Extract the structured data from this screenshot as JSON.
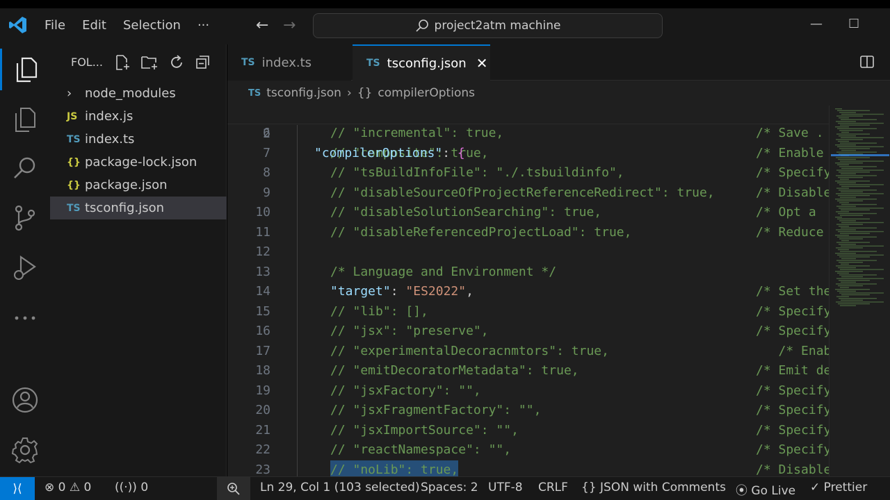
{
  "titlebar": {
    "menu": [
      "File",
      "Edit",
      "Selection",
      "···"
    ],
    "search_text": "project2atm machine",
    "back_arrow": "←",
    "forward_arrow": "→",
    "minimize": "—",
    "maximize": "☐"
  },
  "sidebar": {
    "header": "FOL...",
    "items": [
      {
        "icon": "›",
        "label": "node_modules",
        "type": "folder"
      },
      {
        "icon": "JS",
        "label": "index.js",
        "type": "js"
      },
      {
        "icon": "TS",
        "label": "index.ts",
        "type": "ts"
      },
      {
        "icon": "{}",
        "label": "package-lock.json",
        "type": "json"
      },
      {
        "icon": "{}",
        "label": "package.json",
        "type": "json"
      },
      {
        "icon": "TS",
        "label": "tsconfig.json",
        "type": "ts",
        "selected": true
      }
    ]
  },
  "tabs": [
    {
      "icon": "TS",
      "label": "index.ts"
    },
    {
      "icon": "TS",
      "label": "tsconfig.json",
      "close": "✕"
    }
  ],
  "breadcrumb": {
    "file_icon": "TS",
    "file": "tsconfig.json",
    "sep": "›",
    "symbol_icon": "{}",
    "symbol": "compilerOptions"
  },
  "editor": {
    "sticky": {
      "ln": "2",
      "key": "\"compilerOptions\"",
      "colon": ": ",
      "brace": "{"
    },
    "lines": [
      {
        "ln": "6",
        "code": "// \"incremental\": true,",
        "comment": "/* Save ."
      },
      {
        "ln": "7",
        "code": "// \"composite\": true,",
        "comment": "/* Enable"
      },
      {
        "ln": "8",
        "code": "// \"tsBuildInfoFile\": \"./.tsbuildinfo\",",
        "comment": "/* Specify"
      },
      {
        "ln": "9",
        "code": "// \"disableSourceOfProjectReferenceRedirect\": true,",
        "comment": "/* Disable"
      },
      {
        "ln": "10",
        "code": "// \"disableSolutionSearching\": true,",
        "comment": "/* Opt a"
      },
      {
        "ln": "11",
        "code": "// \"disableReferencedProjectLoad\": true,",
        "comment": "/* Reduce"
      },
      {
        "ln": "12",
        "code": "",
        "comment": ""
      },
      {
        "ln": "13",
        "code": "/* Language and Environment */",
        "comment": ""
      },
      {
        "ln": "14",
        "key": "\"target\"",
        "colon": ": ",
        "str": "\"ES2022\"",
        "comma": ",",
        "comment": "/* Set the"
      },
      {
        "ln": "15",
        "code": "// \"lib\": [],",
        "comment": "/* Specify"
      },
      {
        "ln": "16",
        "code": "// \"jsx\": \"preserve\",",
        "comment": "/* Specify"
      },
      {
        "ln": "17",
        "code": "// \"experimentalDecoracnmtors\": true,",
        "comment": "   /* Enab"
      },
      {
        "ln": "18",
        "code": "// \"emitDecoratorMetadata\": true,",
        "comment": "/* Emit de"
      },
      {
        "ln": "19",
        "code": "// \"jsxFactory\": \"\",",
        "comment": "/* Specify"
      },
      {
        "ln": "20",
        "code": "// \"jsxFragmentFactory\": \"\",",
        "comment": "/* Specify"
      },
      {
        "ln": "21",
        "code": "// \"jsxImportSource\": \"\",",
        "comment": "/* Specify"
      },
      {
        "ln": "22",
        "code": "// \"reactNamespace\": \"\",",
        "comment": "/* Specify"
      },
      {
        "ln": "23",
        "code": "// \"noLib\": true,",
        "comment": "/* Disable",
        "selected": true
      }
    ]
  },
  "statusbar": {
    "remote_icon": "⟩⟨",
    "errors": "0",
    "warnings": "0",
    "ports": "0",
    "position": "Ln 29, Col 1 (103 selected)",
    "spaces": "Spaces: 2",
    "encoding": "UTF-8",
    "eol": "CRLF",
    "language": "JSON with Comments",
    "golive": "Go Live",
    "prettier": "Prettier"
  },
  "colors": {
    "accent": "#0078d4",
    "background": "#1f1f1f",
    "sidebar": "#181818",
    "comment": "#6a9955",
    "key": "#9cdcfe",
    "string": "#ce9178"
  }
}
